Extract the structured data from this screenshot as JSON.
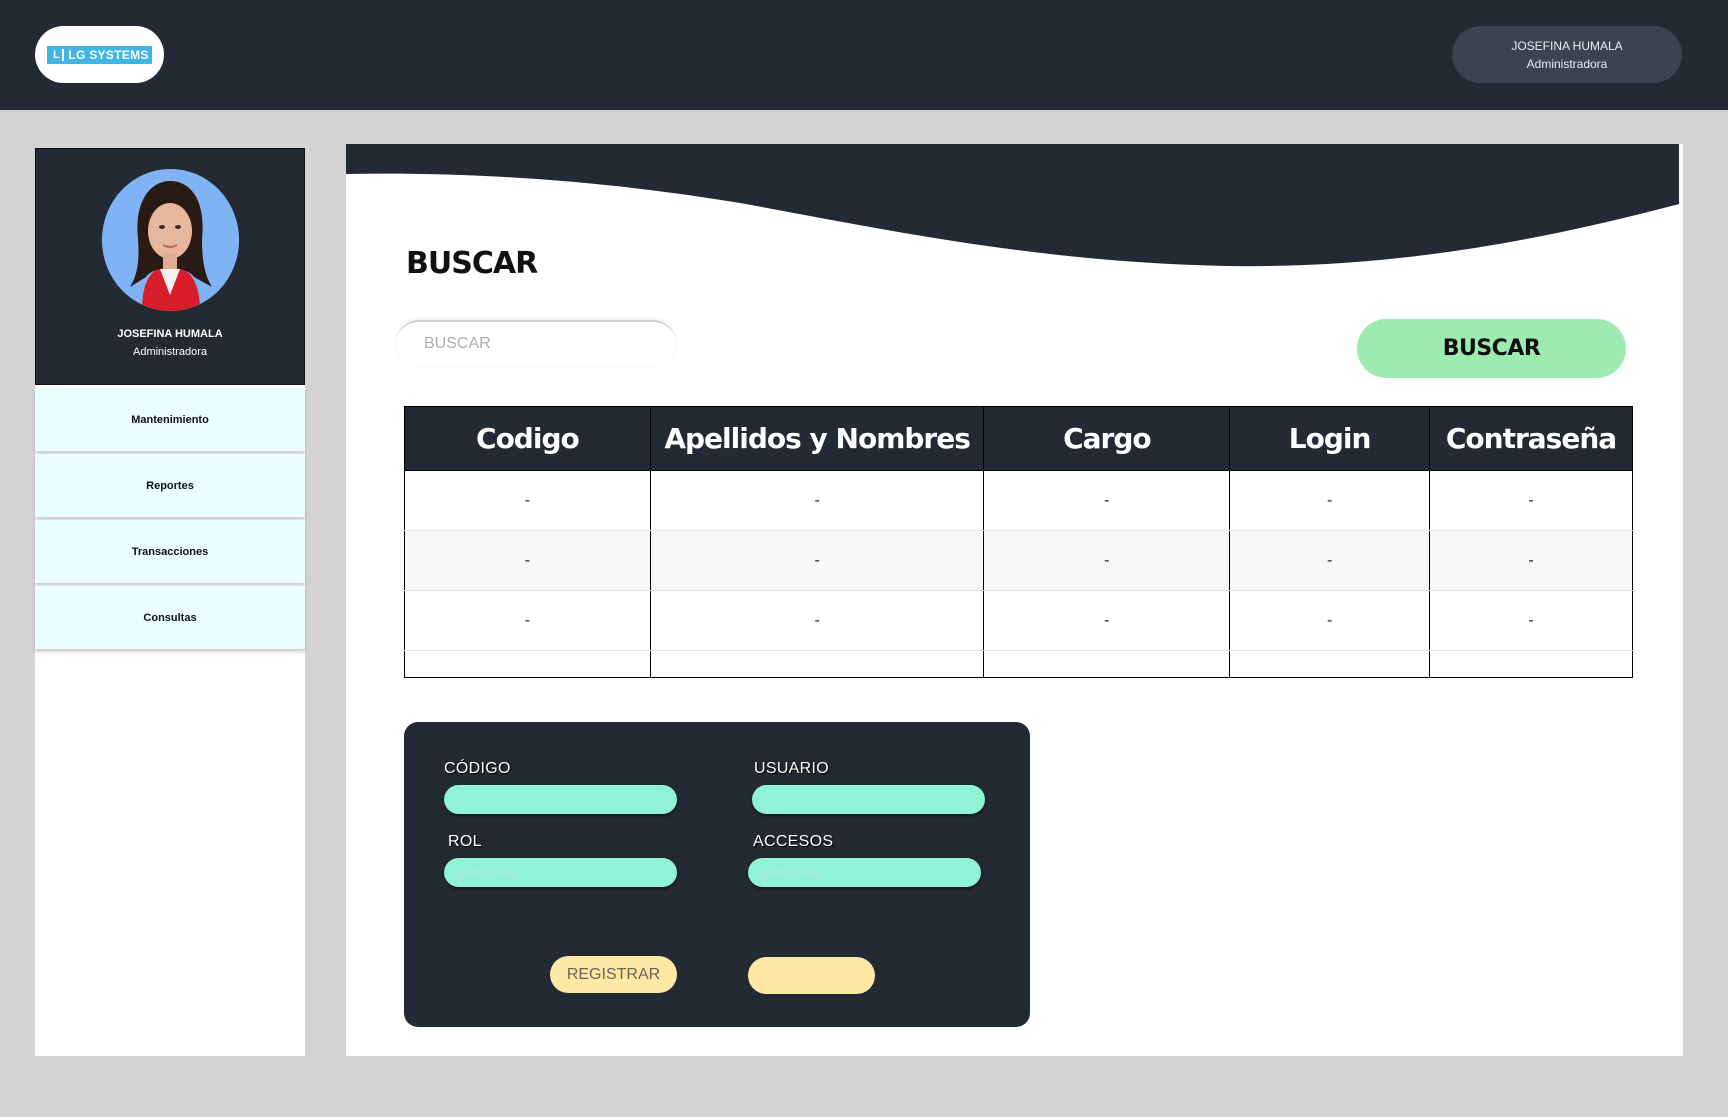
{
  "brand": {
    "badge_letter": "L",
    "name": "LG SYSTEMS"
  },
  "header_user": {
    "name": "JOSEFINA HUMALA",
    "role": "Administradora"
  },
  "profile": {
    "name": "JOSEFINA HUMALA",
    "role": "Administradora"
  },
  "sidebar": {
    "items": [
      {
        "label": "Mantenimiento"
      },
      {
        "label": "Reportes"
      },
      {
        "label": "Transacciones"
      },
      {
        "label": "Consultas"
      }
    ]
  },
  "search": {
    "title": "BUSCAR",
    "placeholder": "BUSCAR",
    "button_label": "BUSCAR"
  },
  "table": {
    "headers": [
      "Codigo",
      "Apellidos y Nombres",
      "Cargo",
      "Login",
      "Contraseña"
    ],
    "rows": [
      [
        "-",
        "-",
        "-",
        "-",
        "-"
      ],
      [
        "-",
        "-",
        "-",
        "-",
        "-"
      ],
      [
        "-",
        "-",
        "-",
        "-",
        "-"
      ]
    ]
  },
  "form": {
    "codigo_label": "CÓDIGO",
    "usuario_label": "USUARIO",
    "rol_label": "ROL",
    "accesos_label": "ACCESOS",
    "rol_placeholder": "Seleccione..",
    "accesos_placeholder": "Seleccione..",
    "register_label": "REGISTRAR",
    "second_button_label": ""
  },
  "colors": {
    "dark": "#232a33",
    "accent_green": "#9eeab1",
    "input_mint": "#90f3d6",
    "button_yellow": "#ffe7a5",
    "menu_bg": "#eafffd",
    "logo_blue": "#3fb6e6"
  }
}
